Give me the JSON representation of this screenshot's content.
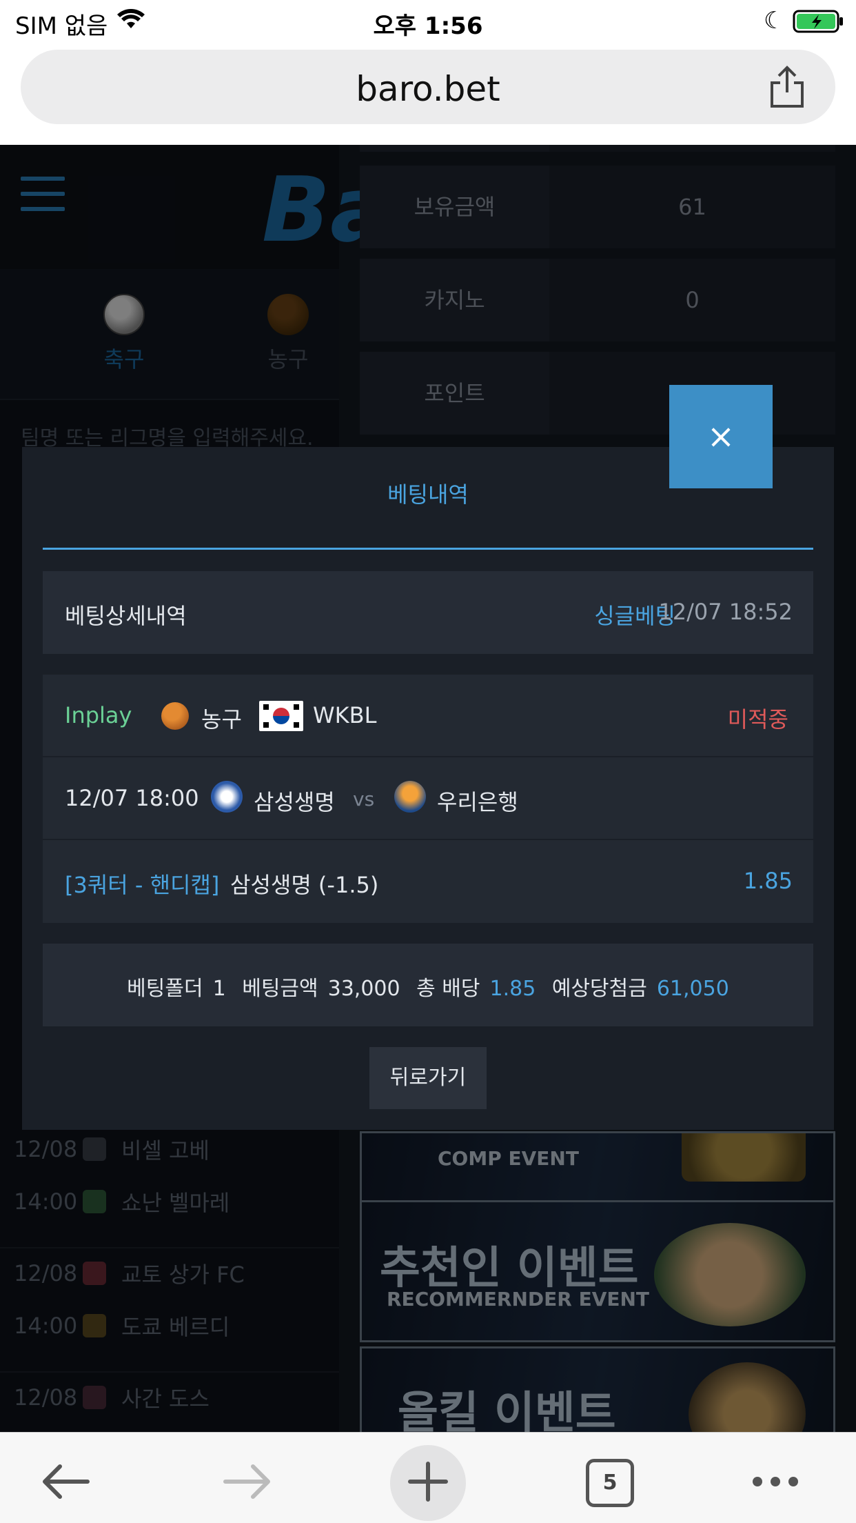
{
  "status_bar": {
    "carrier": "SIM 없음",
    "time": "오후 1:56"
  },
  "browser": {
    "url": "baro.bet",
    "tab_count": "5"
  },
  "background_page": {
    "logo_text": "Ba",
    "sport_tabs": [
      {
        "label": "축구"
      },
      {
        "label": "농구"
      }
    ],
    "search_placeholder": "팀명 또는 리그명을 입력해주세요.",
    "account_info": [
      {
        "label": "보유금액",
        "value": "61"
      },
      {
        "label": "카지노",
        "value": "0"
      },
      {
        "label": "포인트",
        "value": ""
      }
    ],
    "matches": [
      {
        "date": "12/08",
        "time": "14:00",
        "home": "비셀 고베",
        "away": "쇼난 벨마레"
      },
      {
        "date": "12/08",
        "time": "14:00",
        "home": "교토 상가 FC",
        "away": "도쿄 베르디"
      },
      {
        "date": "12/08",
        "time": "",
        "home": "사간 도스",
        "away": ""
      }
    ],
    "banners": [
      {
        "title": "",
        "subtitle": "COMP EVENT"
      },
      {
        "title": "추천인 이벤트",
        "subtitle": "RECOMMERNDER EVENT"
      },
      {
        "title": "올킬 이벤트",
        "subtitle": ""
      }
    ]
  },
  "modal": {
    "close_label": "×",
    "title": "베팅내역",
    "detail_label": "베팅상세내역",
    "bet_type": "싱글베팅",
    "bet_datetime": "12/07 18:52",
    "bet": {
      "status": "Inplay",
      "sport": "농구",
      "league": "WKBL",
      "result": "미적중",
      "match_time": "12/07 18:00",
      "home": "삼성생명",
      "vs": "vs",
      "away": "우리은행",
      "market": "[3쿼터 - 핸디캡]",
      "pick": "삼성생명 (-1.5)",
      "odds": "1.85"
    },
    "summary": {
      "folder_label": "베팅폴더",
      "folder_value": "1",
      "amount_label": "베팅금액",
      "amount_value": "33,000",
      "total_odds_label": "총 배당",
      "total_odds_value": "1.85",
      "expected_label": "예상당첨금",
      "expected_value": "61,050"
    },
    "back_label": "뒤로가기"
  },
  "colors": {
    "accent": "#4aa4e0",
    "close_button": "#3d8fc6",
    "inplay": "#6bd196",
    "lost": "#e05a5a"
  }
}
